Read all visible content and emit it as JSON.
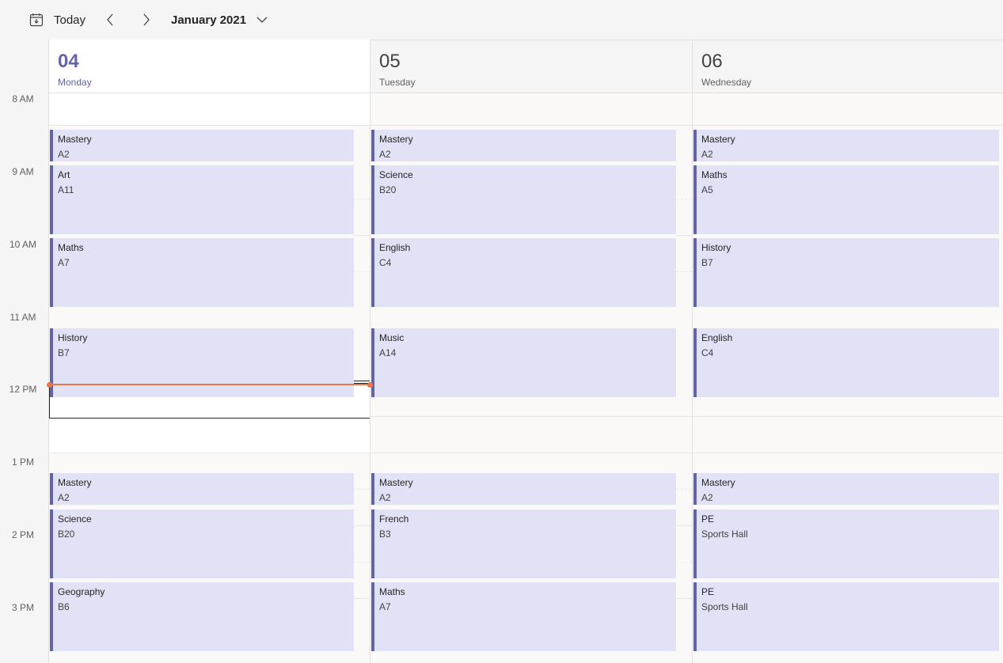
{
  "toolbar": {
    "calendar_icon": "calendar-today-icon",
    "today_label": "Today",
    "prev_icon": "chevron-left-icon",
    "next_icon": "chevron-right-icon",
    "month_label": "January 2021",
    "month_chevron_icon": "chevron-down-icon"
  },
  "days": [
    {
      "number": "04",
      "weekday": "Monday",
      "is_today": true
    },
    {
      "number": "05",
      "weekday": "Tuesday",
      "is_today": false
    },
    {
      "number": "06",
      "weekday": "Wednesday",
      "is_today": false
    }
  ],
  "time_labels": [
    "8 AM",
    "9 AM",
    "10 AM",
    "11 AM",
    "12 PM",
    "1 PM",
    "2 PM",
    "3 PM"
  ],
  "events": {
    "monday": [
      {
        "title": "Mastery",
        "room": "A2"
      },
      {
        "title": "Art",
        "room": "A11"
      },
      {
        "title": "Maths",
        "room": "A7"
      },
      {
        "title": "History",
        "room": "B7"
      },
      {
        "title": "Mastery",
        "room": "A2"
      },
      {
        "title": "Science",
        "room": "B20"
      },
      {
        "title": "Geography",
        "room": "B6"
      }
    ],
    "tuesday": [
      {
        "title": "Mastery",
        "room": "A2"
      },
      {
        "title": "Science",
        "room": "B20"
      },
      {
        "title": "English",
        "room": "C4"
      },
      {
        "title": "Music",
        "room": "A14"
      },
      {
        "title": "Mastery",
        "room": "A2"
      },
      {
        "title": "French",
        "room": "B3"
      },
      {
        "title": "Maths",
        "room": "A7"
      }
    ],
    "wednesday": [
      {
        "title": "Mastery",
        "room": "A2"
      },
      {
        "title": "Maths",
        "room": "A5"
      },
      {
        "title": "History",
        "room": "B7"
      },
      {
        "title": "English",
        "room": "C4"
      },
      {
        "title": "Mastery",
        "room": "A2"
      },
      {
        "title": "PE",
        "room": "Sports Hall"
      },
      {
        "title": "PE",
        "room": "Sports Hall"
      }
    ]
  },
  "colors": {
    "accent": "#6264a7",
    "event_fill": "#e2e2f6",
    "current_time": "#e97548"
  }
}
